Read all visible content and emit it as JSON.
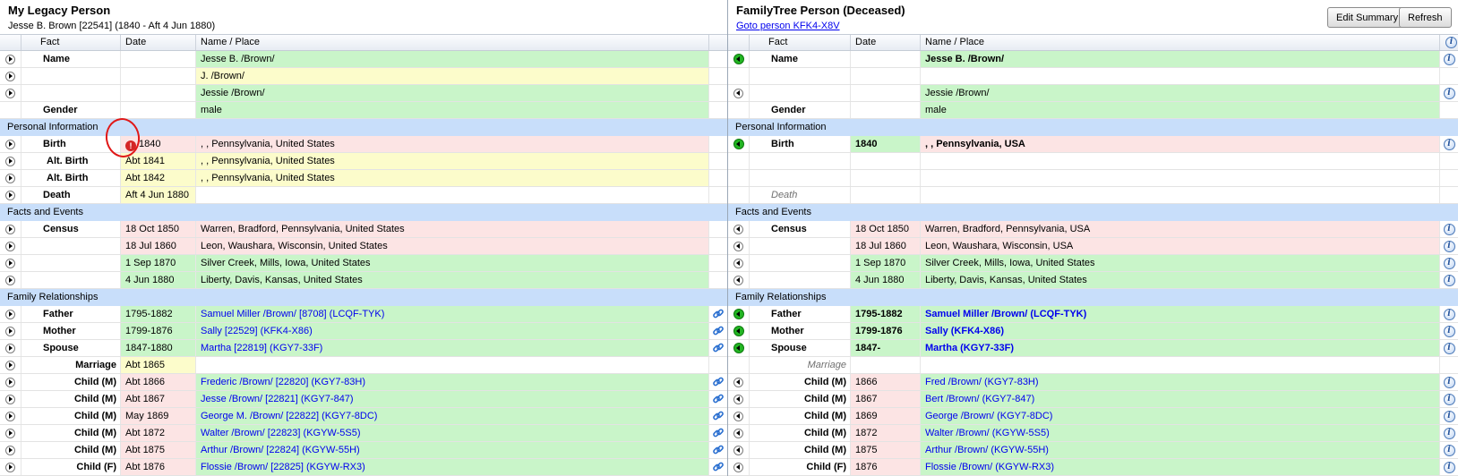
{
  "left": {
    "title": "My Legacy Person",
    "subtitle": "Jesse B. Brown [22541] (1840 - Aft 4 Jun 1880)",
    "columns": [
      "Fact",
      "Date",
      "Name / Place"
    ],
    "rows": [
      {
        "t": "data",
        "fact": "Name",
        "date": "",
        "np": "Jesse B. /Brown/",
        "bg": "green",
        "exp": "expand"
      },
      {
        "t": "data",
        "fact": "",
        "date": "",
        "np": "J. /Brown/",
        "bg": "yellow",
        "exp": "expand"
      },
      {
        "t": "data",
        "fact": "",
        "date": "",
        "np": "Jessie /Brown/",
        "bg": "green",
        "exp": "expand"
      },
      {
        "t": "data",
        "fact": "Gender",
        "date": "",
        "np": "male",
        "bg": "green",
        "exp": "none"
      },
      {
        "t": "section",
        "label": "Personal Information"
      },
      {
        "t": "data",
        "fact": "Birth",
        "date": "1840",
        "np": ", , Pennsylvania, United States",
        "bg": "pink",
        "exp": "expand",
        "warn": true
      },
      {
        "t": "data",
        "fact": "Alt. Birth",
        "date": "Abt 1841",
        "np": ", , Pennsylvania, United States",
        "bg": "yellow",
        "exp": "expand",
        "style": "indent"
      },
      {
        "t": "data",
        "fact": "Alt. Birth",
        "date": "Abt 1842",
        "np": ", , Pennsylvania, United States",
        "bg": "yellow",
        "exp": "expand",
        "style": "indent"
      },
      {
        "t": "data",
        "fact": "Death",
        "date": "Aft 4 Jun 1880",
        "np": "",
        "bg": "yellow",
        "exp": "expand",
        "npbg": "white"
      },
      {
        "t": "section",
        "label": "Facts and Events"
      },
      {
        "t": "data",
        "fact": "Census",
        "date": "18 Oct 1850",
        "np": "Warren, Bradford, Pennsylvania, United States",
        "bg": "pink",
        "exp": "expand"
      },
      {
        "t": "data",
        "fact": "",
        "date": "18 Jul 1860",
        "np": "Leon, Waushara, Wisconsin, United States",
        "bg": "pink",
        "exp": "expand"
      },
      {
        "t": "data",
        "fact": "",
        "date": "1 Sep 1870",
        "np": "Silver Creek, Mills, Iowa, United States",
        "bg": "green",
        "exp": "expand"
      },
      {
        "t": "data",
        "fact": "",
        "date": "4 Jun 1880",
        "np": "Liberty, Davis, Kansas, United States",
        "bg": "green",
        "exp": "expand"
      },
      {
        "t": "section",
        "label": "Family Relationships"
      },
      {
        "t": "data",
        "fact": "Father",
        "date": "1795-1882",
        "np": "Samuel Miller /Brown/ [8708] (LCQF-TYK)",
        "bg": "green",
        "exp": "expand",
        "link": true,
        "act": "link"
      },
      {
        "t": "data",
        "fact": "Mother",
        "date": "1799-1876",
        "np": "Sally  [22529] (KFK4-X86)",
        "bg": "green",
        "exp": "expand",
        "link": true,
        "act": "link"
      },
      {
        "t": "data",
        "fact": "Spouse",
        "date": "1847-1880",
        "np": "Martha  [22819] (KGY7-33F)",
        "bg": "green",
        "exp": "expand",
        "link": true,
        "act": "link"
      },
      {
        "t": "data",
        "fact": "Marriage",
        "date": "Abt 1865",
        "np": "",
        "bg": "yellow",
        "exp": "expand",
        "style": "right",
        "npbg": "white"
      },
      {
        "t": "data",
        "fact": "Child (M)",
        "date": "Abt 1866",
        "np": "Frederic /Brown/ [22820] (KGY7-83H)",
        "bg": "green",
        "exp": "expand",
        "style": "right",
        "link": true,
        "act": "link",
        "datebg": "pink"
      },
      {
        "t": "data",
        "fact": "Child (M)",
        "date": "Abt 1867",
        "np": "Jesse /Brown/ [22821] (KGY7-847)",
        "bg": "green",
        "exp": "expand",
        "style": "right",
        "link": true,
        "act": "link",
        "datebg": "pink"
      },
      {
        "t": "data",
        "fact": "Child (M)",
        "date": "May 1869",
        "np": "George M. /Brown/ [22822] (KGY7-8DC)",
        "bg": "green",
        "exp": "expand",
        "style": "right",
        "link": true,
        "act": "link",
        "datebg": "pink"
      },
      {
        "t": "data",
        "fact": "Child (M)",
        "date": "Abt 1872",
        "np": "Walter /Brown/ [22823] (KGYW-5S5)",
        "bg": "green",
        "exp": "expand",
        "style": "right",
        "link": true,
        "act": "link",
        "datebg": "pink"
      },
      {
        "t": "data",
        "fact": "Child (M)",
        "date": "Abt 1875",
        "np": "Arthur /Brown/ [22824] (KGYW-55H)",
        "bg": "green",
        "exp": "expand",
        "style": "right",
        "link": true,
        "act": "link",
        "datebg": "pink"
      },
      {
        "t": "data",
        "fact": "Child (F)",
        "date": "Abt 1876",
        "np": "Flossie /Brown/ [22825] (KGYW-RX3)",
        "bg": "green",
        "exp": "expand",
        "style": "right",
        "link": true,
        "act": "link",
        "datebg": "pink"
      }
    ]
  },
  "right": {
    "title": "FamilyTree Person (Deceased)",
    "goto_link": "Goto person KFK4-X8V",
    "edit_summary_label": "Edit Summary",
    "refresh_label": "Refresh",
    "columns": [
      "Fact",
      "Date",
      "Name / Place"
    ],
    "rows": [
      {
        "t": "data",
        "fact": "Name",
        "date": "",
        "np": "Jesse B. /Brown/",
        "bg": "green",
        "exp": "green",
        "bold": true,
        "act": "info"
      },
      {
        "t": "data",
        "fact": "",
        "date": "",
        "np": "",
        "bg": "white",
        "exp": "none",
        "act": "none"
      },
      {
        "t": "data",
        "fact": "",
        "date": "",
        "np": "Jessie /Brown/",
        "bg": "green",
        "exp": "back",
        "act": "info"
      },
      {
        "t": "data",
        "fact": "Gender",
        "date": "",
        "np": "male",
        "bg": "green",
        "exp": "none",
        "act": "none"
      },
      {
        "t": "section",
        "label": "Personal Information"
      },
      {
        "t": "data",
        "fact": "Birth",
        "date": "1840",
        "np": ", , Pennsylvania, USA",
        "bg": "pink",
        "exp": "green",
        "bold": true,
        "act": "info",
        "datebg": "green"
      },
      {
        "t": "data",
        "fact": "",
        "date": "",
        "np": "",
        "bg": "white",
        "exp": "none",
        "act": "none"
      },
      {
        "t": "data",
        "fact": "",
        "date": "",
        "np": "",
        "bg": "white",
        "exp": "none",
        "act": "none"
      },
      {
        "t": "data",
        "fact": "Death",
        "date": "",
        "np": "",
        "bg": "white",
        "exp": "none",
        "act": "none",
        "style": "muted"
      },
      {
        "t": "section",
        "label": "Facts and Events"
      },
      {
        "t": "data",
        "fact": "Census",
        "date": "18 Oct 1850",
        "np": "Warren, Bradford, Pennsylvania, USA",
        "bg": "pink",
        "exp": "back",
        "act": "info"
      },
      {
        "t": "data",
        "fact": "",
        "date": "18 Jul 1860",
        "np": "Leon, Waushara, Wisconsin, USA",
        "bg": "pink",
        "exp": "back",
        "act": "info"
      },
      {
        "t": "data",
        "fact": "",
        "date": "1 Sep 1870",
        "np": "Silver Creek, Mills, Iowa, United States",
        "bg": "green",
        "exp": "back",
        "act": "info"
      },
      {
        "t": "data",
        "fact": "",
        "date": "4 Jun 1880",
        "np": "Liberty, Davis, Kansas, United States",
        "bg": "green",
        "exp": "back",
        "act": "info"
      },
      {
        "t": "section",
        "label": "Family Relationships"
      },
      {
        "t": "data",
        "fact": "Father",
        "date": "1795-1882",
        "np": "Samuel Miller /Brown/ (LCQF-TYK)",
        "bg": "green",
        "exp": "green",
        "bold": true,
        "link": true,
        "act": "info"
      },
      {
        "t": "data",
        "fact": "Mother",
        "date": "1799-1876",
        "np": "Sally  (KFK4-X86)",
        "bg": "green",
        "exp": "green",
        "bold": true,
        "link": true,
        "act": "info"
      },
      {
        "t": "data",
        "fact": "Spouse",
        "date": "1847-",
        "np": "Martha  (KGY7-33F)",
        "bg": "green",
        "exp": "green",
        "bold": true,
        "link": true,
        "act": "info"
      },
      {
        "t": "data",
        "fact": "Marriage",
        "date": "",
        "np": "",
        "bg": "white",
        "exp": "none",
        "act": "none",
        "style": "right-muted"
      },
      {
        "t": "data",
        "fact": "Child (M)",
        "date": "1866",
        "np": "Fred /Brown/ (KGY7-83H)",
        "bg": "green",
        "exp": "back",
        "style": "right",
        "link": true,
        "act": "info",
        "datebg": "pink"
      },
      {
        "t": "data",
        "fact": "Child (M)",
        "date": "1867",
        "np": "Bert /Brown/ (KGY7-847)",
        "bg": "green",
        "exp": "back",
        "style": "right",
        "link": true,
        "act": "info",
        "datebg": "pink"
      },
      {
        "t": "data",
        "fact": "Child (M)",
        "date": "1869",
        "np": "George /Brown/ (KGY7-8DC)",
        "bg": "green",
        "exp": "back",
        "style": "right",
        "link": true,
        "act": "info",
        "datebg": "pink"
      },
      {
        "t": "data",
        "fact": "Child (M)",
        "date": "1872",
        "np": "Walter /Brown/ (KGYW-5S5)",
        "bg": "green",
        "exp": "back",
        "style": "right",
        "link": true,
        "act": "info",
        "datebg": "pink"
      },
      {
        "t": "data",
        "fact": "Child (M)",
        "date": "1875",
        "np": "Arthur /Brown/ (KGYW-55H)",
        "bg": "green",
        "exp": "back",
        "style": "right",
        "link": true,
        "act": "info",
        "datebg": "pink"
      },
      {
        "t": "data",
        "fact": "Child (F)",
        "date": "1876",
        "np": "Flossie /Brown/ (KGYW-RX3)",
        "bg": "green",
        "exp": "back",
        "style": "right",
        "link": true,
        "act": "info",
        "datebg": "pink"
      }
    ]
  },
  "icons": {
    "expand": "expand-arrow-icon",
    "back": "collapse-left-icon",
    "green": "green-left-arrow-icon",
    "link": "chain-link-icon",
    "info": "info-icon",
    "warn": "warning-icon"
  },
  "colors": {
    "match_green": "#c9f5c9",
    "partial_yellow": "#fcfccb",
    "mismatch_pink": "#fce4e4",
    "section_blue": "#c8defa",
    "link_blue": "#0000ee",
    "warning_red": "#d42626"
  }
}
